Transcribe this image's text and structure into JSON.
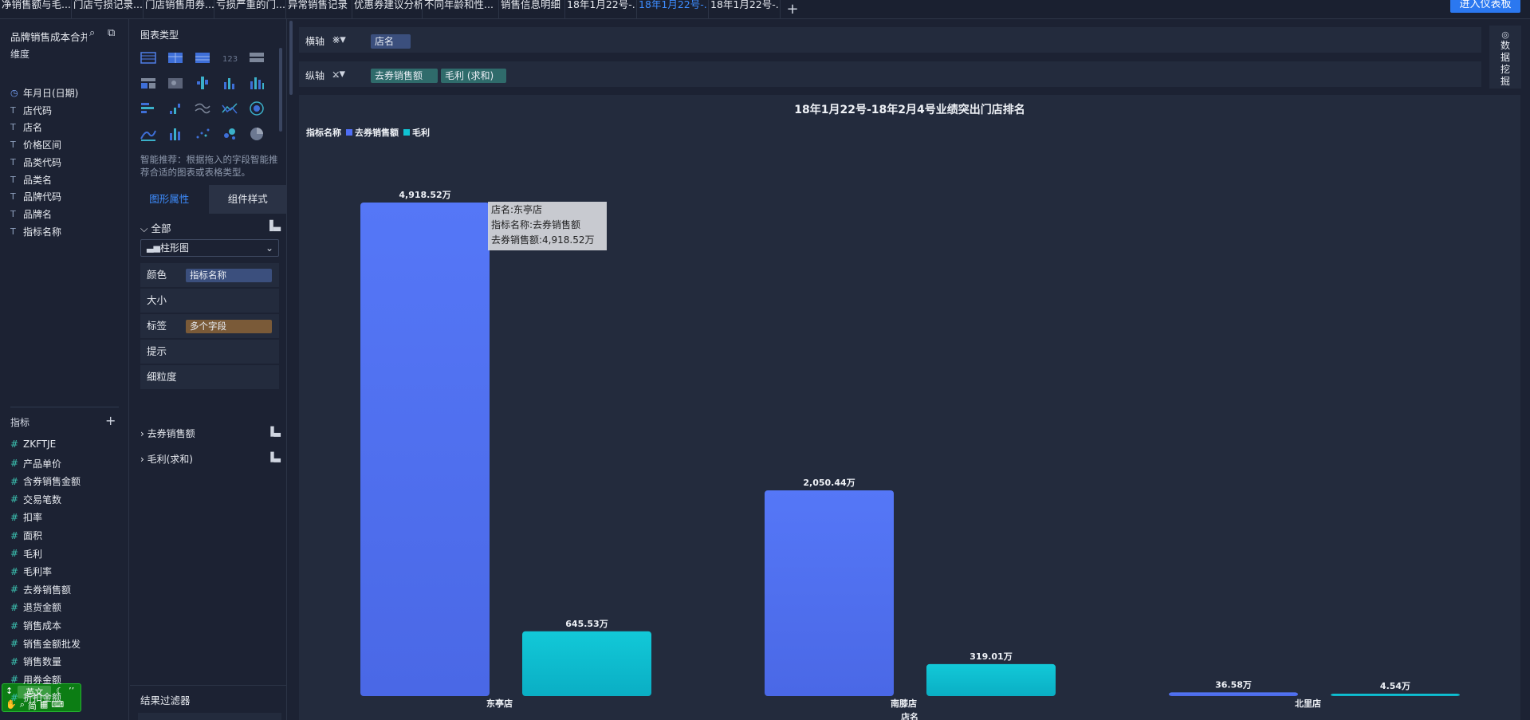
{
  "tabs": [
    {
      "label": "净销售额与毛...",
      "width": 90,
      "active": false
    },
    {
      "label": "门店亏损记录...",
      "width": 90,
      "active": false
    },
    {
      "label": "门店销售用券...",
      "width": 89,
      "active": false
    },
    {
      "label": "亏损严重的门...",
      "width": 90,
      "active": false
    },
    {
      "label": "异常销售记录",
      "width": 83,
      "active": false
    },
    {
      "label": "优惠券建议分析",
      "width": 88,
      "active": false
    },
    {
      "label": "不同年龄和性...",
      "width": 96,
      "active": false
    },
    {
      "label": "销售信息明细",
      "width": 83,
      "active": false
    },
    {
      "label": "18年1月22号-...",
      "width": 90,
      "active": false
    },
    {
      "label": "18年1月22号-...",
      "width": 90,
      "active": true
    },
    {
      "label": "18年1月22号-...",
      "width": 90,
      "active": false
    }
  ],
  "dashboard_button": "进入仪表板",
  "sidebar": {
    "dataset_name": "品牌销售成本合并",
    "dimensions_title": "维度",
    "dimensions": [
      {
        "type": "clock",
        "label": "年月日(日期)"
      },
      {
        "type": "T",
        "label": "店代码"
      },
      {
        "type": "T",
        "label": "店名"
      },
      {
        "type": "T",
        "label": "价格区间"
      },
      {
        "type": "T",
        "label": "品类代码"
      },
      {
        "type": "T",
        "label": "品类名"
      },
      {
        "type": "T",
        "label": "品牌代码"
      },
      {
        "type": "T",
        "label": "品牌名"
      },
      {
        "type": "T",
        "label": "指标名称"
      }
    ],
    "measures_title": "指标",
    "measures": [
      "ZKFTJE",
      "产品单价",
      "含券销售金额",
      "交易笔数",
      "扣率",
      "面积",
      "毛利",
      "毛利率",
      "去券销售额",
      "退货金额",
      "销售成本",
      "销售金额批发",
      "销售数量",
      "用券金额",
      "折扣金额"
    ],
    "ime": {
      "lang": "英文",
      "mode": "简"
    }
  },
  "panel": {
    "chart_types_title": "图表类型",
    "hint": "智能推荐：根据拖入的字段智能推荐合适的图表或表格类型。",
    "tab_props": "图形属性",
    "tab_style": "组件样式",
    "all_label": "全部",
    "chart_select": "柱形图",
    "marks": [
      {
        "label": "颜色",
        "chip": "指标名称",
        "chip_color": "#3b4f7d"
      },
      {
        "label": "大小",
        "chip": "",
        "chip_color": ""
      },
      {
        "label": "标签",
        "chip": "多个字段",
        "chip_color": "#7a5a38"
      },
      {
        "label": "提示",
        "chip": "",
        "chip_color": ""
      },
      {
        "label": "细粒度",
        "chip": "",
        "chip_color": ""
      }
    ],
    "measure_groups": [
      "去券销售额",
      "毛利(求和)"
    ],
    "result_filter": "结果过滤器"
  },
  "shelves": {
    "x_label": "横轴",
    "x_chips": [
      {
        "label": "店名",
        "color": "#3b4f7d"
      }
    ],
    "y_label": "纵轴",
    "y_chips": [
      {
        "label": "去券销售额",
        "color": "#2f6b6b"
      },
      {
        "label": "毛利 (求和)",
        "color": "#2f6b6b"
      }
    ]
  },
  "data_mining": "数据挖掘",
  "tooltip": {
    "lines": [
      "店名:东亭店",
      "指标名称:去券销售额",
      "去券销售额:4,918.52万"
    ]
  },
  "chart_data": {
    "type": "bar",
    "title": "18年1月22号-18年2月4号业绩突出门店排名",
    "legend_title": "指标名称",
    "legend_position": "top-left",
    "xlabel": "店名",
    "categories": [
      "东亭店",
      "南膝店",
      "北里店"
    ],
    "series": [
      {
        "name": "去券销售额",
        "color": "#4f6ef5",
        "values": [
          4918.52
        ],
        "labels": [
          "4,918.52万",
          "2,050.44万",
          "36.58万"
        ],
        "all_values": [
          4918.52,
          2050.44,
          36.58
        ]
      },
      {
        "name": "毛利",
        "color": "#10c2d2",
        "labels": [
          "645.53万",
          "319.01万",
          "4.54万"
        ],
        "all_values": [
          645.53,
          319.01,
          4.54
        ]
      }
    ],
    "ylim": [
      0,
      4918.52
    ],
    "grid": false
  }
}
